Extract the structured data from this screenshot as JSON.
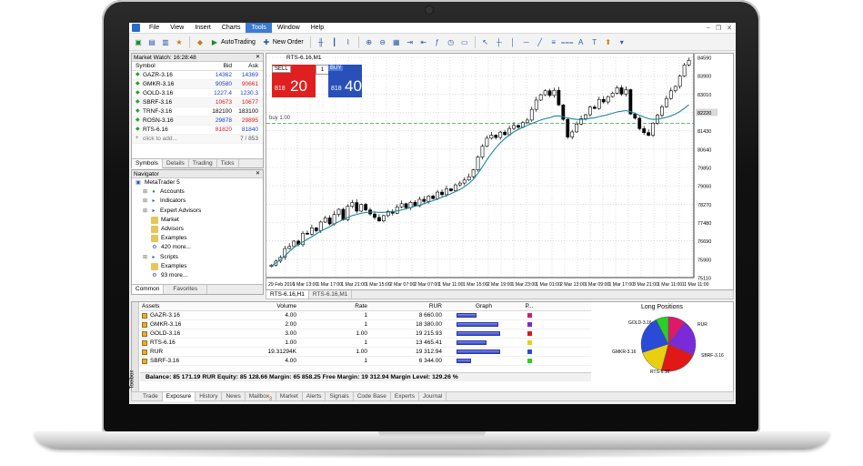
{
  "menu": [
    "File",
    "View",
    "Insert",
    "Charts",
    "Tools",
    "Window",
    "Help"
  ],
  "menu_active": "Tools",
  "toolbar": {
    "autotrading": "AutoTrading",
    "new_order": "New Order"
  },
  "market_watch": {
    "title": "Market Watch: 16:28:48",
    "columns": [
      "Symbol",
      "Bid",
      "Ask"
    ],
    "rows": [
      {
        "symbol": "GAZR-3.16",
        "bid": "14362",
        "ask": "14369",
        "bid_color": "#1a3fd0",
        "ask_color": "#1a3fd0"
      },
      {
        "symbol": "GMKR-3.16",
        "bid": "90580",
        "ask": "90661",
        "bid_color": "#1a3fd0",
        "ask_color": "#e01818"
      },
      {
        "symbol": "GOLD-3.16",
        "bid": "1227.4",
        "ask": "1230.3",
        "bid_color": "#1a3fd0",
        "ask_color": "#1a3fd0"
      },
      {
        "symbol": "SBRF-3.16",
        "bid": "10673",
        "ask": "10677",
        "bid_color": "#e01818",
        "ask_color": "#e01818"
      },
      {
        "symbol": "TRNF-3.16",
        "bid": "182100",
        "ask": "183100",
        "bid_color": "#000000",
        "ask_color": "#000000"
      },
      {
        "symbol": "ROSN-3.16",
        "bid": "29878",
        "ask": "29895",
        "bid_color": "#1a3fd0",
        "ask_color": "#e01818"
      },
      {
        "symbol": "RTS-6.16",
        "bid": "81820",
        "ask": "81840",
        "bid_color": "#e01818",
        "ask_color": "#1a3fd0"
      }
    ],
    "add_label": "click to add...",
    "count": "7 / 853",
    "tabs": [
      "Symbols",
      "Details",
      "Trading",
      "Ticks"
    ]
  },
  "navigator": {
    "title": "Navigator",
    "items": [
      {
        "label": "MetaTrader 5",
        "indent": 0,
        "icon": "terminal-icon"
      },
      {
        "label": "Accounts",
        "indent": 1,
        "icon": "accounts-icon"
      },
      {
        "label": "Indicators",
        "indent": 1,
        "icon": "indicators-icon"
      },
      {
        "label": "Expert Advisors",
        "indent": 1,
        "icon": "experts-icon"
      },
      {
        "label": "Market",
        "indent": 2,
        "icon": "folder-icon"
      },
      {
        "label": "Advisors",
        "indent": 2,
        "icon": "folder-icon"
      },
      {
        "label": "Examples",
        "indent": 2,
        "icon": "folder-icon"
      },
      {
        "label": "420 more...",
        "indent": 2,
        "icon": "expert-icon"
      },
      {
        "label": "Scripts",
        "indent": 1,
        "icon": "scripts-icon"
      },
      {
        "label": "Examples",
        "indent": 2,
        "icon": "folder-icon"
      },
      {
        "label": "93 more...",
        "indent": 2,
        "icon": "script-icon"
      }
    ],
    "tabs": [
      "Common",
      "Favorites"
    ]
  },
  "chart": {
    "symbol_title": "RTS-6.16,M1",
    "sell_label": "SELL",
    "buy_label": "BUY",
    "lot": "1",
    "sell_price_small": "818",
    "sell_price_big": "20",
    "buy_price_small": "818",
    "buy_price_big": "40",
    "buy_line_label": "buy 1.00",
    "tabs": [
      "RTS-6.16,H1",
      "RTS-6.16,M1"
    ],
    "colors": {
      "sell": "#e02020",
      "buy": "#2850b8",
      "ma": "#1a8a9a",
      "buy_line": "#2fa84a"
    }
  },
  "chart_data": {
    "type": "candlestick",
    "price_axis": [
      "84590",
      "83900",
      "83010",
      "82220",
      "81430",
      "80640",
      "79850",
      "79060",
      "78270",
      "77480",
      "76690",
      "75900",
      "75110"
    ],
    "highlighted_price": [
      "82220"
    ],
    "time_axis": [
      "29 Feb 2016",
      "1 Mar 13:00",
      "1 Mar 17:00",
      "1 Mar 21:00",
      "1 Mar 15:00",
      "2 Mar 07:00",
      "2 Mar 07:00",
      "1 Mar 11:00",
      "1 Mar 15:00",
      "2 Mar 19:00",
      "1 Mar 23:00",
      "1 Mar 01:00",
      "2 Mar 13:00",
      "1 Mar 09:00",
      "1 Mar 17:00",
      "3 Mar 21:00",
      "1 Mar 11:00",
      "11 Mar 11:00"
    ],
    "closes": [
      75650,
      75820,
      75980,
      76360,
      76450,
      76680,
      76530,
      77020,
      76980,
      77250,
      77130,
      77500,
      77680,
      77420,
      77830,
      78050,
      77600,
      78180,
      78340,
      77970,
      78260,
      78020,
      77850,
      77700,
      77550,
      77780,
      77960,
      77880,
      78150,
      78290,
      78120,
      78350,
      78200,
      78480,
      78390,
      78620,
      78510,
      78790,
      78680,
      78930,
      78850,
      79100,
      79180,
      79310,
      79450,
      79750,
      80300,
      80760,
      81110,
      81240,
      81140,
      81370,
      81260,
      81530,
      81660,
      81580,
      81780,
      81890,
      82350,
      82750,
      82980,
      83150,
      82950,
      83170,
      82540,
      81920,
      81160,
      81380,
      81720,
      81950,
      82120,
      82450,
      82390,
      82780,
      82670,
      82900,
      83050,
      83280,
      83010,
      83200,
      82150,
      81970,
      81520,
      81350,
      81230,
      81760,
      82100,
      82460,
      82820,
      83150,
      83340,
      83780,
      84260,
      84460
    ],
    "ma": [
      75600,
      75740,
      75890,
      76040,
      76240,
      76400,
      76540,
      76640,
      76760,
      76870,
      76990,
      77110,
      77210,
      77300,
      77420,
      77520,
      77600,
      77690,
      77780,
      77830,
      77880,
      77910,
      77930,
      77930,
      77920,
      77920,
      77930,
      77940,
      77980,
      78020,
      78070,
      78120,
      78180,
      78230,
      78290,
      78360,
      78420,
      78490,
      78570,
      78640,
      78720,
      78810,
      78900,
      79020,
      79160,
      79340,
      79590,
      79880,
      80180,
      80450,
      80700,
      80910,
      81090,
      81240,
      81380,
      81480,
      81580,
      81660,
      81740,
      81820,
      81890,
      81950,
      81990,
      82060,
      82070,
      82030,
      81980,
      81940,
      81920,
      81920,
      81930,
      81960,
      81990,
      82040,
      82080,
      82130,
      82180,
      82240,
      82270,
      82300,
      82250,
      82180,
      82100,
      82020,
      81950,
      81920,
      81930,
      81960,
      82010,
      82070,
      82150,
      82260,
      82400,
      82550
    ],
    "buy_level": 81750,
    "ylim": [
      75110,
      84590
    ]
  },
  "toolbox": {
    "side_label": "Toolbox",
    "columns": [
      "Assets",
      "Volume",
      "Rate",
      "RUR",
      "Graph",
      "P..."
    ],
    "rows": [
      {
        "asset": "GAZR-3.16",
        "volume": "4.00",
        "rate": "1",
        "rur": "8 660.00",
        "share": 0.36,
        "color": "#e0186a"
      },
      {
        "asset": "GMKR-3.16",
        "volume": "2.00",
        "rate": "1",
        "rur": "18 380.00",
        "share": 0.74,
        "color": "#7a2ad8"
      },
      {
        "asset": "GOLD-3.16",
        "volume": "3.00",
        "rate": "1.00",
        "rur": "19 215.93",
        "share": 0.77,
        "color": "#e01818"
      },
      {
        "asset": "RTS-6.16",
        "volume": "1.00",
        "rate": "1",
        "rur": "13 465.41",
        "share": 0.54,
        "color": "#e8d010"
      },
      {
        "asset": "RUR",
        "volume": "19.31294K",
        "rate": "1.00",
        "rur": "19 312.94",
        "share": 0.78,
        "color": "#2a4ad8"
      },
      {
        "asset": "SBRF-3.16",
        "volume": "4.00",
        "rate": "1",
        "rur": "6 344.00",
        "share": 0.25,
        "color": "#28d028"
      }
    ],
    "balance": "Balance: 85 171.19 RUR  Equity: 85 128.66  Margin: 65 858.25  Free Margin: 19 312.94  Margin Level: 129.26 %",
    "long_positions_title": "Long Positions",
    "pie_labels": [
      "GOLD-3.16",
      "RUR",
      "GMKR-3.16",
      "SBRF-3.16",
      "RTS-6.16"
    ],
    "tabs": [
      "Trade",
      "Exposure",
      "History",
      "News",
      "Mailbox",
      "Market",
      "Alerts",
      "Signals",
      "Code Base",
      "Experts",
      "Journal"
    ],
    "mailbox_badge": "3",
    "active_tab": "Exposure"
  }
}
